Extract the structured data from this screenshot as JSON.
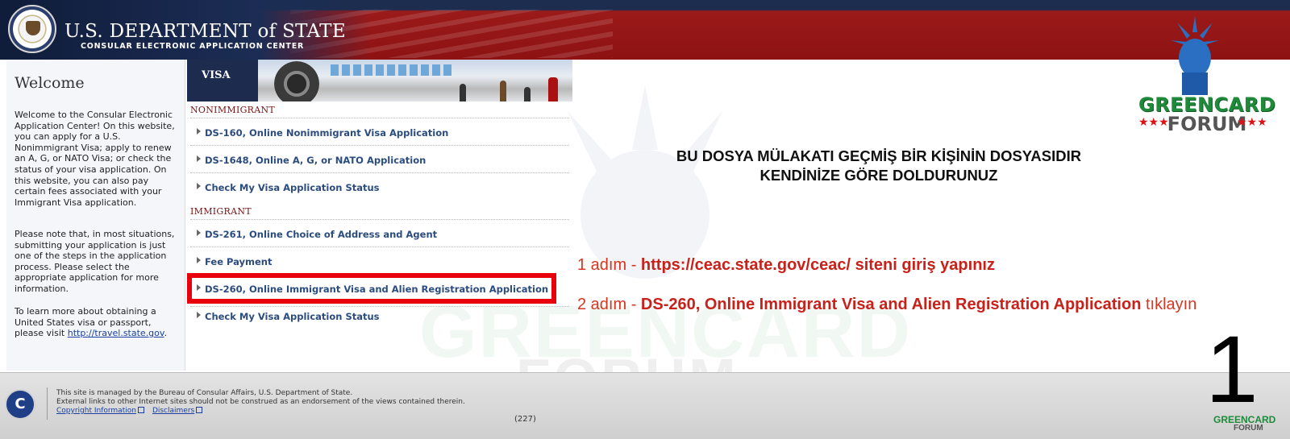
{
  "header": {
    "title": "U.S. DEPARTMENT of STATE",
    "subtitle": "CONSULAR ELECTRONIC APPLICATION CENTER"
  },
  "logo": {
    "green_text": "GREENCARD",
    "forum_text": "FORUM",
    "stars": "★★★"
  },
  "sidebar": {
    "heading": "Welcome",
    "para1": "Welcome to the Consular Electronic Application Center! On this website, you can apply for a U.S. Nonimmigrant Visa; apply to renew an A, G, or NATO Visa; or check the status of your visa application. On this website, you can also pay certain fees associated with your Immigrant Visa application.",
    "para2": "Please note that, in most situations, submitting your application is just one of the steps in the application process. Please select the appropriate application for more information.",
    "para3_prefix": "To learn more about obtaining a United States visa or passport, please visit ",
    "para3_link": "http://travel.state.gov",
    "para3_suffix": "."
  },
  "visa_panel": {
    "banner_label": "VISA",
    "nonimmigrant_label": "NONIMMIGRANT",
    "nonimmigrant_links": [
      "DS-160, Online Nonimmigrant Visa Application",
      "DS-1648, Online A, G, or NATO Application",
      "Check My Visa Application Status"
    ],
    "immigrant_label": "IMMIGRANT",
    "immigrant_links": [
      "DS-261, Online Choice of Address and Agent",
      "Fee Payment",
      "DS-260, Online Immigrant Visa and Alien Registration Application",
      "Check My Visa Application Status"
    ]
  },
  "overlay": {
    "title_line1": "BU DOSYA MÜLAKATI GEÇMİŞ BİR KİŞİNİN DOSYASIDIR",
    "title_line2": "KENDİNİZE GÖRE DOLDURUNUZ",
    "step1_prefix": "1 adım - ",
    "step1_bold": "https://ceac.state.gov/ceac/ siteni giriş yapınız",
    "step2_prefix": "2 adım - ",
    "step2_bold": "DS-260, Online Immigrant Visa and Alien Registration Application",
    "step2_suffix": " tıklayın",
    "page_number": "1"
  },
  "footer": {
    "line1": "This site is managed by the Bureau of Consular Affairs, U.S. Department of State.",
    "line2": "External links to other Internet sites should not be construed as an endorsement of the views contained therein.",
    "link1": "Copyright Information",
    "link2": "Disclaimers",
    "page_count": "(227)",
    "seal_letter": "C"
  },
  "colors": {
    "header_red": "#8e1212",
    "header_navy": "#1c2d4f",
    "link_blue": "#2b4c7e",
    "highlight_red": "#e8000d",
    "step_red": "#d4361f",
    "logo_green": "#1f8a3a"
  }
}
